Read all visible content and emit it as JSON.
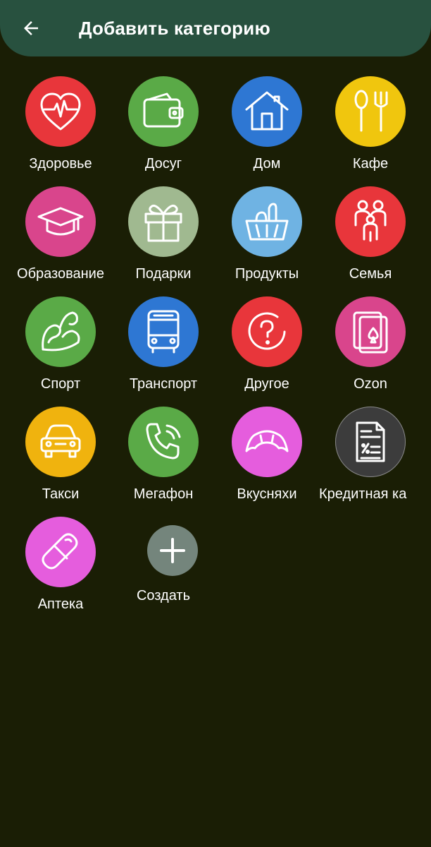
{
  "header": {
    "title": "Добавить категорию",
    "back_icon": "arrow-left-icon",
    "background": "#28513f"
  },
  "page": {
    "background": "#1a1e05"
  },
  "categories": [
    {
      "label": "Здоровье",
      "icon": "heart-pulse-icon",
      "color": "#e8363b"
    },
    {
      "label": "Досуг",
      "icon": "wallet-icon",
      "color": "#5aaa47"
    },
    {
      "label": "Дом",
      "icon": "house-icon",
      "color": "#2e77d3"
    },
    {
      "label": "Кафе",
      "icon": "spoon-fork-icon",
      "color": "#f0c60e"
    },
    {
      "label": "Образование",
      "icon": "graduation-cap-icon",
      "color": "#d9458c"
    },
    {
      "label": "Подарки",
      "icon": "gift-icon",
      "color": "#a0b990"
    },
    {
      "label": "Продукты",
      "icon": "grocery-basket-icon",
      "color": "#6fb3e3"
    },
    {
      "label": "Семья",
      "icon": "family-icon",
      "color": "#e8363b"
    },
    {
      "label": "Спорт",
      "icon": "muscle-arm-icon",
      "color": "#5aaa47"
    },
    {
      "label": "Транспорт",
      "icon": "bus-icon",
      "color": "#2e77d3"
    },
    {
      "label": "Другое",
      "icon": "question-icon",
      "color": "#e8363b"
    },
    {
      "label": "Ozon",
      "icon": "playing-cards-icon",
      "color": "#d9458c"
    },
    {
      "label": "Такси",
      "icon": "taxi-car-icon",
      "color": "#f0b30e"
    },
    {
      "label": "Мегафон",
      "icon": "phone-icon",
      "color": "#5aaa47"
    },
    {
      "label": "Вкусняхи",
      "icon": "croissant-icon",
      "color": "#e55ddd"
    },
    {
      "label": "Кредитная ка",
      "icon": "document-percent-icon",
      "color": "#3c3c3c"
    },
    {
      "label": "Аптека",
      "icon": "pill-icon",
      "color": "#e55ddd"
    }
  ],
  "create": {
    "label": "Создать",
    "icon": "plus-icon",
    "color": "#74857c"
  }
}
